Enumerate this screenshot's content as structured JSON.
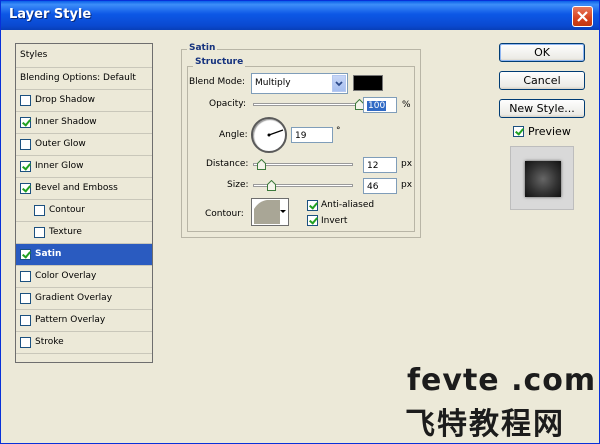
{
  "window": {
    "title": "Layer Style"
  },
  "styles_list": {
    "header": "Styles",
    "blending_options": "Blending Options: Default",
    "items": [
      {
        "label": "Drop Shadow",
        "checked": false,
        "indent": false,
        "selected": false
      },
      {
        "label": "Inner Shadow",
        "checked": true,
        "indent": false,
        "selected": false
      },
      {
        "label": "Outer Glow",
        "checked": false,
        "indent": false,
        "selected": false
      },
      {
        "label": "Inner Glow",
        "checked": true,
        "indent": false,
        "selected": false
      },
      {
        "label": "Bevel and Emboss",
        "checked": true,
        "indent": false,
        "selected": false
      },
      {
        "label": "Contour",
        "checked": false,
        "indent": true,
        "selected": false
      },
      {
        "label": "Texture",
        "checked": false,
        "indent": true,
        "selected": false
      },
      {
        "label": "Satin",
        "checked": true,
        "indent": false,
        "selected": true
      },
      {
        "label": "Color Overlay",
        "checked": false,
        "indent": false,
        "selected": false
      },
      {
        "label": "Gradient Overlay",
        "checked": false,
        "indent": false,
        "selected": false
      },
      {
        "label": "Pattern Overlay",
        "checked": false,
        "indent": false,
        "selected": false
      },
      {
        "label": "Stroke",
        "checked": false,
        "indent": false,
        "selected": false
      }
    ]
  },
  "satin": {
    "group_title": "Satin",
    "structure_title": "Structure",
    "blend_mode": {
      "label": "Blend Mode:",
      "value": "Multiply",
      "color": "#000000"
    },
    "opacity": {
      "label": "Opacity:",
      "value": "100",
      "unit": "%",
      "fraction": 1.0
    },
    "angle": {
      "label": "Angle:",
      "value": "19",
      "unit": "°"
    },
    "distance": {
      "label": "Distance:",
      "value": "12",
      "unit": "px",
      "fraction": 0.08
    },
    "size": {
      "label": "Size:",
      "value": "46",
      "unit": "px",
      "fraction": 0.18
    },
    "contour": {
      "label": "Contour:"
    },
    "anti_aliased": {
      "label": "Anti-aliased",
      "checked": true
    },
    "invert": {
      "label": "Invert",
      "checked": true
    }
  },
  "buttons": {
    "ok": "OK",
    "cancel": "Cancel",
    "new_style": "New Style...",
    "preview": "Preview",
    "preview_checked": true
  },
  "watermark": {
    "latin": "fevte .com",
    "cjk": "飞特教程网"
  },
  "colors": {
    "title_bar": "#0a49d0",
    "selected": "#2a5bc0",
    "group_title": "#16337e"
  }
}
